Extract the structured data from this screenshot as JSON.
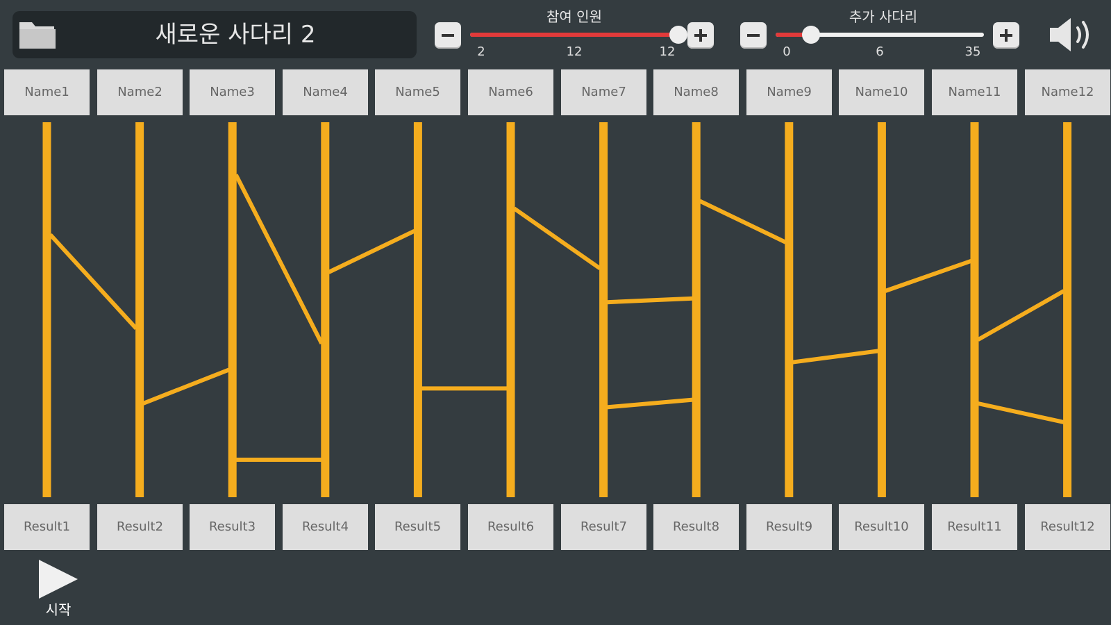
{
  "header": {
    "folder_icon": "folder-icon",
    "title": "새로운 사다리 2",
    "speaker_icon": "speaker-volume-icon"
  },
  "participants": {
    "label": "참여 인원",
    "min_label": "2",
    "value_label": "12",
    "max_label": "12",
    "min": 2,
    "value": 12,
    "max": 12,
    "minus_icon": "minus-icon",
    "plus_icon": "plus-icon"
  },
  "extra_ladders": {
    "label": "추가 사다리",
    "min_label": "0",
    "value_label": "6",
    "max_label": "35",
    "min": 0,
    "value": 6,
    "max": 35,
    "minus_icon": "minus-icon",
    "plus_icon": "plus-icon"
  },
  "names": [
    "Name1",
    "Name2",
    "Name3",
    "Name4",
    "Name5",
    "Name6",
    "Name7",
    "Name8",
    "Name9",
    "Name10",
    "Name11",
    "Name12"
  ],
  "results": [
    "Result1",
    "Result2",
    "Result3",
    "Result4",
    "Result5",
    "Result6",
    "Result7",
    "Result8",
    "Result9",
    "Result10",
    "Result11",
    "Result12"
  ],
  "ladder": {
    "color": "#f5ad1e",
    "rungs": [
      {
        "from": 1,
        "to": 2,
        "y_from": 0.3,
        "y_to": 0.55
      },
      {
        "from": 2,
        "to": 3,
        "y_from": 0.75,
        "y_to": 0.66
      },
      {
        "from": 3,
        "to": 4,
        "y_from": 0.14,
        "y_to": 0.59
      },
      {
        "from": 3,
        "to": 4,
        "y_from": 0.9,
        "y_to": 0.9
      },
      {
        "from": 4,
        "to": 5,
        "y_from": 0.4,
        "y_to": 0.29
      },
      {
        "from": 5,
        "to": 6,
        "y_from": 0.71,
        "y_to": 0.71
      },
      {
        "from": 6,
        "to": 7,
        "y_from": 0.23,
        "y_to": 0.39
      },
      {
        "from": 7,
        "to": 8,
        "y_from": 0.48,
        "y_to": 0.47
      },
      {
        "from": 7,
        "to": 8,
        "y_from": 0.76,
        "y_to": 0.74
      },
      {
        "from": 8,
        "to": 9,
        "y_from": 0.21,
        "y_to": 0.32
      },
      {
        "from": 9,
        "to": 10,
        "y_from": 0.64,
        "y_to": 0.61
      },
      {
        "from": 10,
        "to": 11,
        "y_from": 0.45,
        "y_to": 0.37
      },
      {
        "from": 11,
        "to": 12,
        "y_from": 0.58,
        "y_to": 0.45
      },
      {
        "from": 11,
        "to": 12,
        "y_from": 0.75,
        "y_to": 0.8
      }
    ]
  },
  "start": {
    "icon": "play-icon",
    "label": "시작"
  },
  "colors": {
    "background": "#343c40",
    "title_box": "#22282b",
    "cell": "#dedede",
    "slider_fill": "#e23a3a",
    "ladder": "#f5ad1e"
  }
}
